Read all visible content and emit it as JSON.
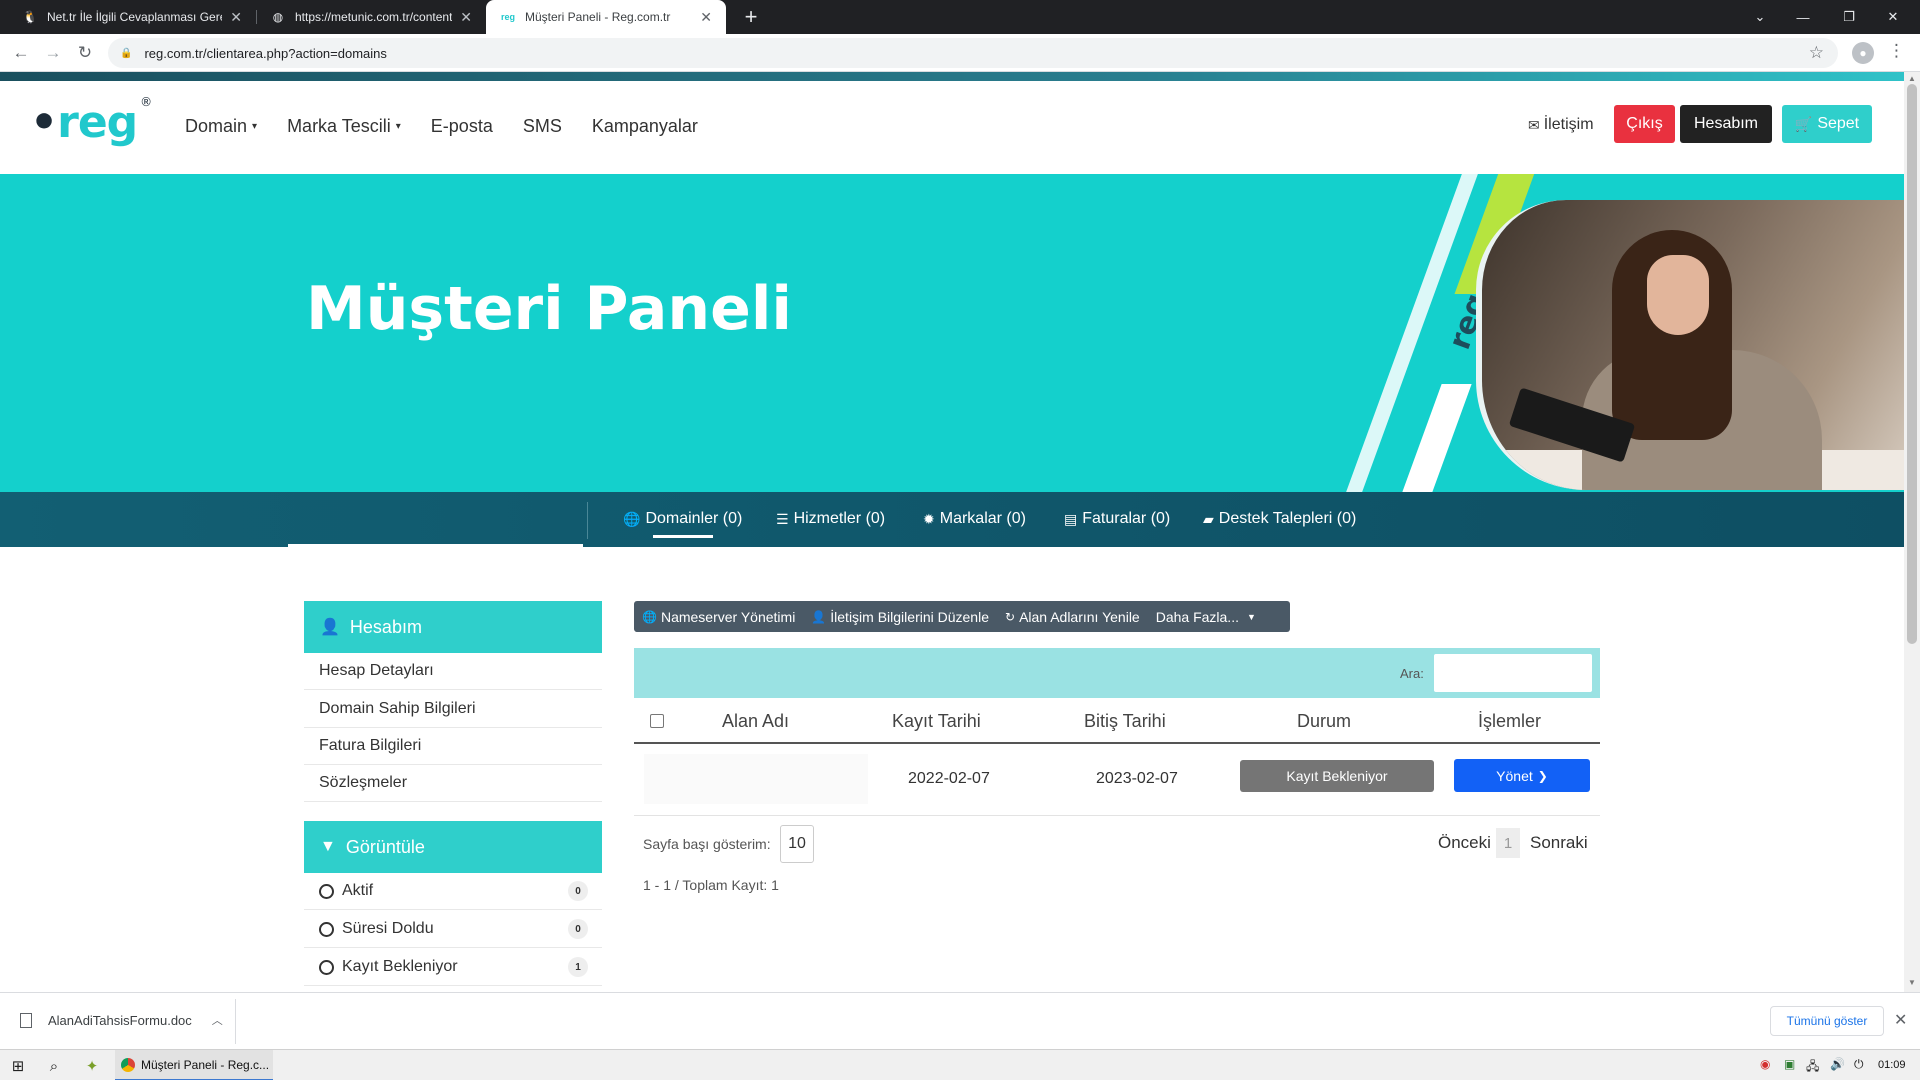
{
  "browser": {
    "tabs": [
      {
        "title": "Net.tr İle İlgili Cevaplanması Gere",
        "active": false
      },
      {
        "title": "https://metunic.com.tr/content/b",
        "active": false
      },
      {
        "title": "Müşteri Paneli - Reg.com.tr",
        "active": true,
        "favicon": "reg"
      }
    ],
    "url": "reg.com.tr/clientarea.php?action=domains"
  },
  "site": {
    "logo_text": "reg",
    "logo_mark": "®",
    "menu": [
      {
        "label": "Domain",
        "has_dropdown": true
      },
      {
        "label": "Marka Tescili",
        "has_dropdown": true
      },
      {
        "label": "E-posta",
        "has_dropdown": false
      },
      {
        "label": "SMS",
        "has_dropdown": false
      },
      {
        "label": "Kampanyalar",
        "has_dropdown": false
      }
    ],
    "contact_label": "İletişim",
    "logout_label": "Çıkış",
    "account_label": "Hesabım",
    "cart_label": "Sepet",
    "hero_title": "Müşteri Paneli",
    "hero_side_logo": "reg"
  },
  "tabnav": [
    {
      "label": "Domainler (0)",
      "icon": "globe-icon",
      "active": true
    },
    {
      "label": "Hizmetler (0)",
      "icon": "list-icon",
      "active": false
    },
    {
      "label": "Markalar (0)",
      "icon": "badge-icon",
      "active": false
    },
    {
      "label": "Faturalar (0)",
      "icon": "file-icon",
      "active": false
    },
    {
      "label": "Destek Talepleri (0)",
      "icon": "comment-icon",
      "active": false
    }
  ],
  "sidebar": {
    "account_title": "Hesabım",
    "account_items": [
      "Hesap Detayları",
      "Domain Sahip Bilgileri",
      "Fatura Bilgileri",
      "Sözleşmeler"
    ],
    "filter_title": "Görüntüle",
    "filter_items": [
      {
        "label": "Aktif",
        "count": "0"
      },
      {
        "label": "Süresi Doldu",
        "count": "0"
      },
      {
        "label": "Kayıt Bekleniyor",
        "count": "1"
      }
    ]
  },
  "toolbar": {
    "nameserver": "Nameserver Yönetimi",
    "contact_edit": "İletişim Bilgilerini Düzenle",
    "renew": "Alan Adlarını Yenile",
    "more": "Daha Fazla..."
  },
  "search": {
    "label": "Ara:",
    "placeholder": ""
  },
  "table": {
    "headers": {
      "domain": "Alan Adı",
      "reg_date": "Kayıt Tarihi",
      "expiry": "Bitiş Tarihi",
      "status": "Durum",
      "actions": "İşlemler"
    },
    "rows": [
      {
        "domain": "",
        "reg_date": "2022-02-07",
        "expiry": "2023-02-07",
        "status": "Kayıt Bekleniyor",
        "action": "Yönet"
      }
    ]
  },
  "pagination": {
    "page_size_label": "Sayfa başı gösterim:",
    "page_size": "10",
    "prev": "Önceki",
    "current": "1",
    "next": "Sonraki",
    "total": "1 - 1 / Toplam Kayıt: 1"
  },
  "downloads": {
    "file": "AlanAdiTahsisFormu.doc",
    "show_all": "Tümünü göster"
  },
  "taskbar": {
    "app_title": "Müşteri Paneli - Reg.c...",
    "clock": "01:09"
  },
  "colors": {
    "brand": "#21c8cc",
    "hero": "#14d0cc",
    "nav": "#125f73",
    "logout": "#e9313f",
    "account": "#222222",
    "cart": "#2fcfcb",
    "manage": "#1261f6",
    "status": "#757575"
  }
}
